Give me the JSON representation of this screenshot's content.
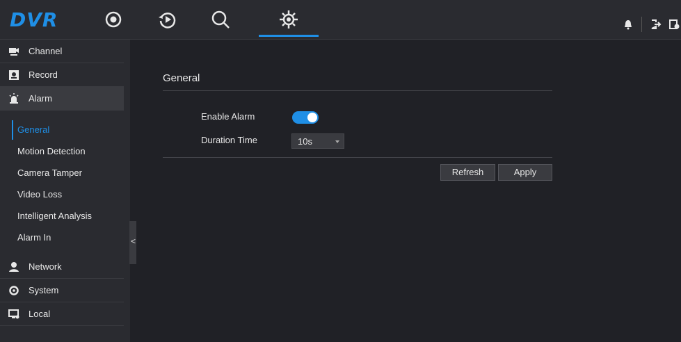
{
  "app": {
    "logo": "DVR"
  },
  "topnav": {
    "items": [
      {
        "name": "live-view",
        "icon": "live-view-icon"
      },
      {
        "name": "playback",
        "icon": "playback-icon"
      },
      {
        "name": "search",
        "icon": "search-icon"
      },
      {
        "name": "settings",
        "icon": "gear-icon",
        "active": true
      }
    ],
    "right_icons": [
      "bell-icon",
      "logout-icon",
      "info-icon"
    ]
  },
  "sidebar": {
    "items": [
      {
        "label": "Channel",
        "icon": "camera-icon"
      },
      {
        "label": "Record",
        "icon": "record-icon"
      },
      {
        "label": "Alarm",
        "icon": "alarm-light-icon",
        "active": true,
        "subitems": [
          {
            "label": "General",
            "active": true
          },
          {
            "label": "Motion Detection"
          },
          {
            "label": "Camera Tamper"
          },
          {
            "label": "Video Loss"
          },
          {
            "label": "Intelligent Analysis"
          },
          {
            "label": "Alarm In"
          }
        ]
      },
      {
        "label": "Network",
        "icon": "network-user-icon"
      },
      {
        "label": "System",
        "icon": "system-gear-icon"
      },
      {
        "label": "Local",
        "icon": "local-monitor-icon"
      }
    ],
    "collapse_glyph": "<"
  },
  "main": {
    "title": "General",
    "enable_alarm": {
      "label": "Enable Alarm",
      "value": true
    },
    "duration": {
      "label": "Duration Time",
      "value": "10s"
    },
    "buttons": {
      "refresh": "Refresh",
      "apply": "Apply"
    }
  },
  "colors": {
    "accent": "#1f8fe6",
    "bg": "#202126",
    "panel": "#2a2b30"
  }
}
